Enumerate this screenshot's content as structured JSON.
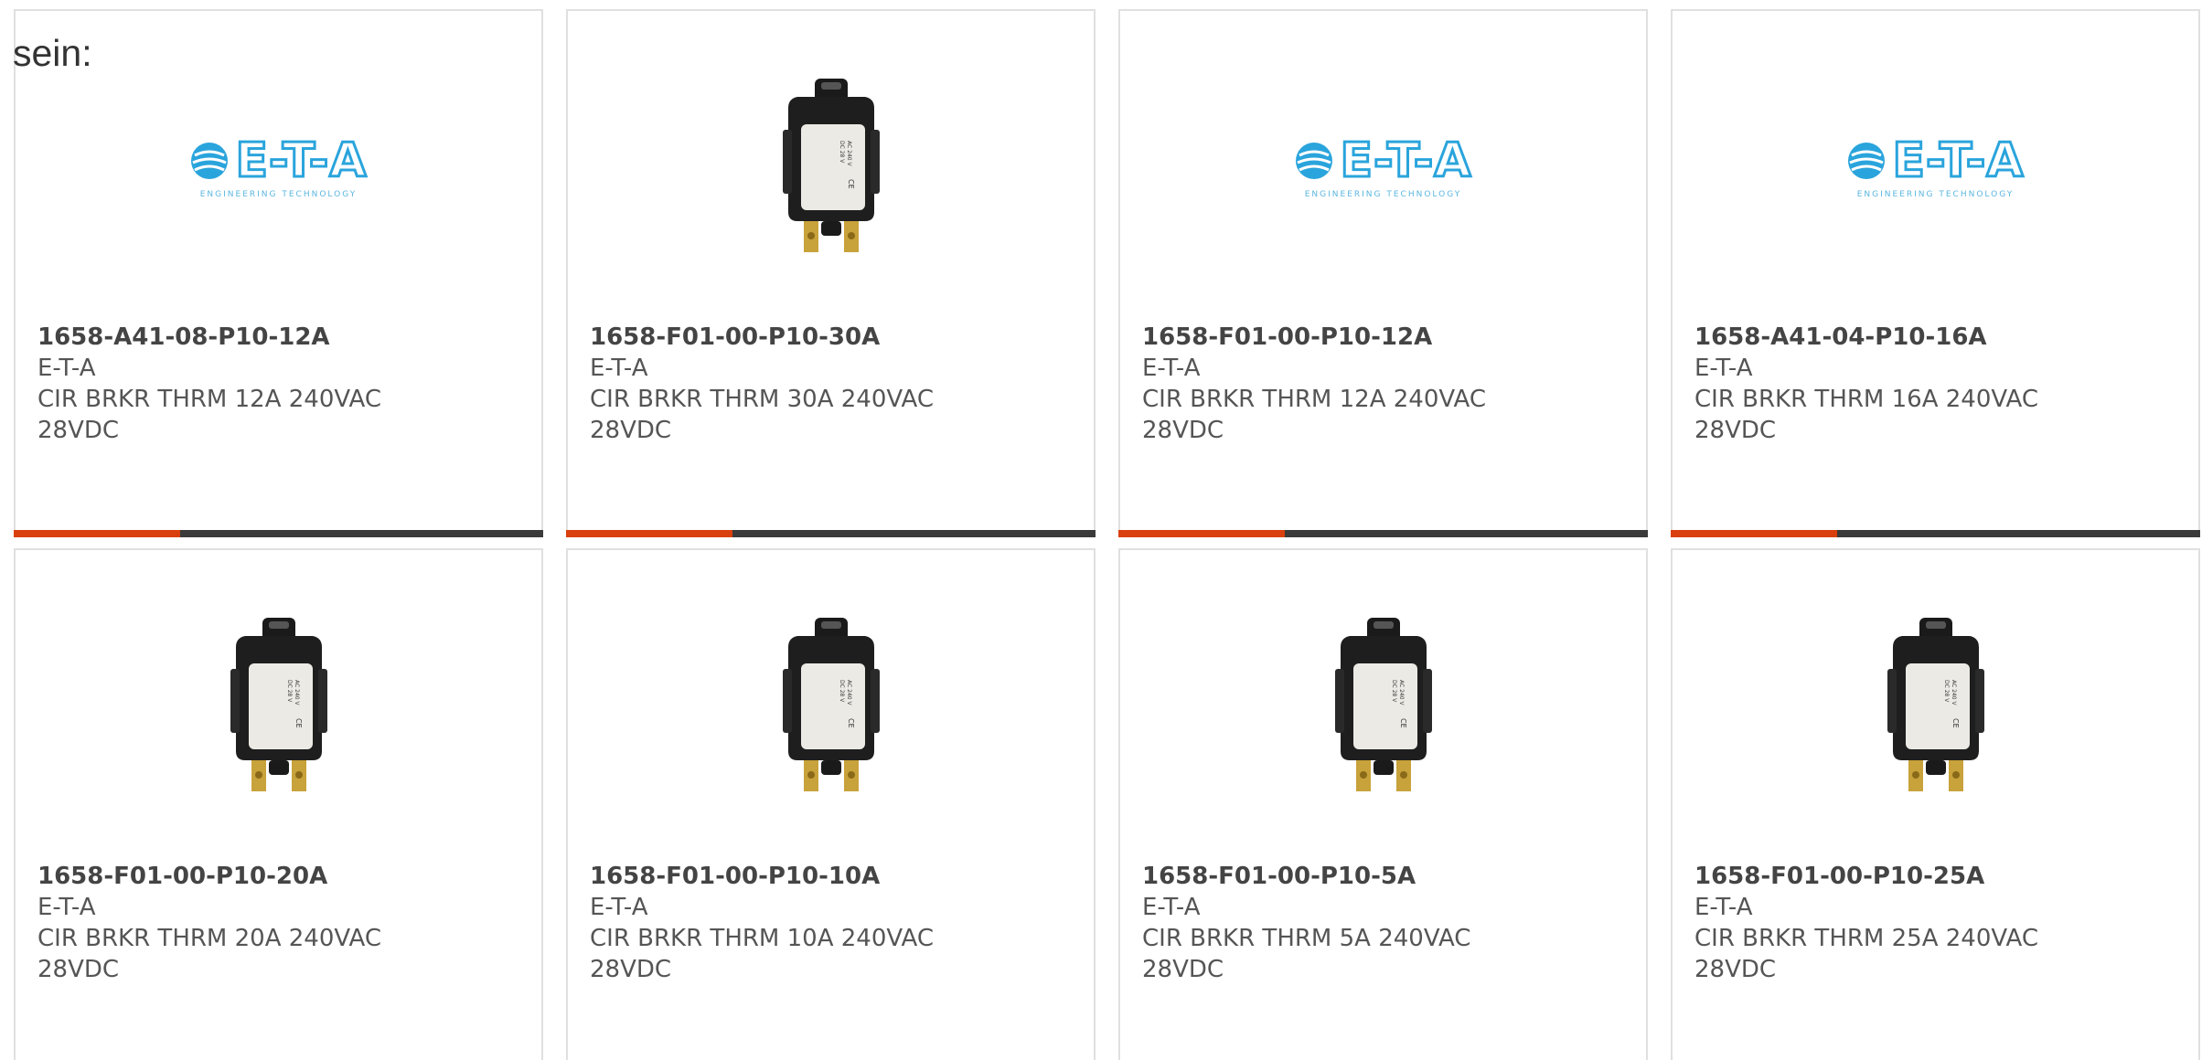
{
  "intro_text": "sein:",
  "colors": {
    "accent": "#d9400d",
    "bar": "#3a3a3a",
    "logo_blue": "#2aa4dc"
  },
  "products": [
    {
      "part_number": "1658-A41-08-P10-12A",
      "manufacturer": "E-T-A",
      "desc_line1": "CIR BRKR THRM 12A 240VAC",
      "desc_line2": "28VDC",
      "image": "eta-logo",
      "logo_text": "E-T-A",
      "logo_sub": "ENGINEERING TECHNOLOGY"
    },
    {
      "part_number": "1658-F01-00-P10-30A",
      "manufacturer": "E-T-A",
      "desc_line1": "CIR BRKR THRM 30A 240VAC",
      "desc_line2": "28VDC",
      "image": "circuit-breaker"
    },
    {
      "part_number": "1658-F01-00-P10-12A",
      "manufacturer": "E-T-A",
      "desc_line1": "CIR BRKR THRM 12A 240VAC",
      "desc_line2": "28VDC",
      "image": "eta-logo",
      "logo_text": "E-T-A",
      "logo_sub": "ENGINEERING TECHNOLOGY"
    },
    {
      "part_number": "1658-A41-04-P10-16A",
      "manufacturer": "E-T-A",
      "desc_line1": "CIR BRKR THRM 16A 240VAC",
      "desc_line2": "28VDC",
      "image": "eta-logo",
      "logo_text": "E-T-A",
      "logo_sub": "ENGINEERING TECHNOLOGY"
    },
    {
      "part_number": "1658-F01-00-P10-20A",
      "manufacturer": "E-T-A",
      "desc_line1": "CIR BRKR THRM 20A 240VAC",
      "desc_line2": "28VDC",
      "image": "circuit-breaker"
    },
    {
      "part_number": "1658-F01-00-P10-10A",
      "manufacturer": "E-T-A",
      "desc_line1": "CIR BRKR THRM 10A 240VAC",
      "desc_line2": "28VDC",
      "image": "circuit-breaker"
    },
    {
      "part_number": "1658-F01-00-P10-5A",
      "manufacturer": "E-T-A",
      "desc_line1": "CIR BRKR THRM 5A 240VAC",
      "desc_line2": "28VDC",
      "image": "circuit-breaker"
    },
    {
      "part_number": "1658-F01-00-P10-25A",
      "manufacturer": "E-T-A",
      "desc_line1": "CIR BRKR THRM 25A 240VAC",
      "desc_line2": "28VDC",
      "image": "circuit-breaker"
    }
  ]
}
